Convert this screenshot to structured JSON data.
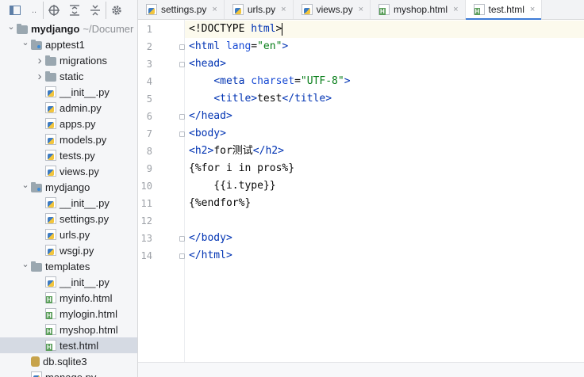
{
  "toolbar": {
    "project_icon": "project-view-icon",
    "dropdown_label": "..",
    "icons": [
      "crosshair-icon",
      "expand-all-icon",
      "collapse-all-icon",
      "gear-icon"
    ]
  },
  "tree": [
    {
      "label": "mydjango",
      "suffix": "~/Documer",
      "kind": "folder",
      "level": 0,
      "arrow": "open",
      "bold": true
    },
    {
      "label": "apptest1",
      "kind": "folder-dot",
      "level": 1,
      "arrow": "open"
    },
    {
      "label": "migrations",
      "kind": "folder",
      "level": 2,
      "arrow": "closed"
    },
    {
      "label": "static",
      "kind": "folder",
      "level": 2,
      "arrow": "closed"
    },
    {
      "label": "__init__.py",
      "kind": "py",
      "level": 2
    },
    {
      "label": "admin.py",
      "kind": "py",
      "level": 2
    },
    {
      "label": "apps.py",
      "kind": "py",
      "level": 2
    },
    {
      "label": "models.py",
      "kind": "py",
      "level": 2
    },
    {
      "label": "tests.py",
      "kind": "py",
      "level": 2
    },
    {
      "label": "views.py",
      "kind": "py",
      "level": 2
    },
    {
      "label": "mydjango",
      "kind": "folder-dot",
      "level": 1,
      "arrow": "open"
    },
    {
      "label": "__init__.py",
      "kind": "py",
      "level": 2
    },
    {
      "label": "settings.py",
      "kind": "py",
      "level": 2
    },
    {
      "label": "urls.py",
      "kind": "py",
      "level": 2
    },
    {
      "label": "wsgi.py",
      "kind": "py",
      "level": 2
    },
    {
      "label": "templates",
      "kind": "folder",
      "level": 1,
      "arrow": "open"
    },
    {
      "label": "__init__.py",
      "kind": "py",
      "level": 2
    },
    {
      "label": "myinfo.html",
      "kind": "html",
      "level": 2
    },
    {
      "label": "mylogin.html",
      "kind": "html",
      "level": 2
    },
    {
      "label": "myshop.html",
      "kind": "html",
      "level": 2
    },
    {
      "label": "test.html",
      "kind": "html",
      "level": 2,
      "selected": true
    },
    {
      "label": "db.sqlite3",
      "kind": "db",
      "level": 1
    },
    {
      "label": "manage.py",
      "kind": "py",
      "level": 1
    }
  ],
  "tabs": [
    {
      "label": "settings.py",
      "kind": "py"
    },
    {
      "label": "urls.py",
      "kind": "py"
    },
    {
      "label": "views.py",
      "kind": "py"
    },
    {
      "label": "myshop.html",
      "kind": "html"
    },
    {
      "label": "test.html",
      "kind": "html",
      "active": true
    }
  ],
  "tab_close": "×",
  "editor": {
    "current_line": 1,
    "lines": [
      [
        [
          "t",
          "<!DOCTYPE "
        ],
        [
          "g",
          "html"
        ],
        [
          "t",
          ">"
        ]
      ],
      [
        [
          "g",
          "<html "
        ],
        [
          "a",
          "lang"
        ],
        [
          "t",
          "="
        ],
        [
          "s",
          "\"en\""
        ],
        [
          "g",
          ">"
        ]
      ],
      [
        [
          "g",
          "<head>"
        ]
      ],
      [
        [
          "t",
          "    "
        ],
        [
          "g",
          "<meta "
        ],
        [
          "a",
          "charset"
        ],
        [
          "t",
          "="
        ],
        [
          "s",
          "\"UTF-8\""
        ],
        [
          "g",
          ">"
        ]
      ],
      [
        [
          "t",
          "    "
        ],
        [
          "g",
          "<title>"
        ],
        [
          "t",
          "test"
        ],
        [
          "g",
          "</title>"
        ]
      ],
      [
        [
          "g",
          "</head>"
        ]
      ],
      [
        [
          "g",
          "<body>"
        ]
      ],
      [
        [
          "g",
          "<h2>"
        ],
        [
          "t",
          "for测试"
        ],
        [
          "g",
          "</h2>"
        ]
      ],
      [
        [
          "t",
          "{%for i in pros%}"
        ]
      ],
      [
        [
          "t",
          "    {{i.type}}"
        ]
      ],
      [
        [
          "t",
          "{%endfor%}"
        ]
      ],
      [
        [
          "t",
          ""
        ]
      ],
      [
        [
          "g",
          "</body>"
        ]
      ],
      [
        [
          "g",
          "</html>"
        ]
      ]
    ],
    "fold_lines": [
      2,
      3,
      6,
      7,
      13,
      14
    ]
  }
}
